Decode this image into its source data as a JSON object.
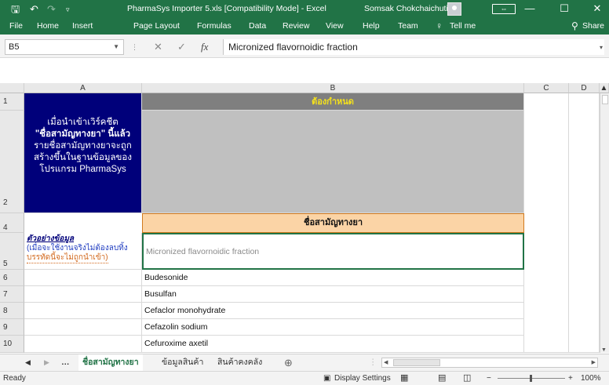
{
  "titlebar": {
    "title": "PharmaSys Importer 5.xls  [Compatibility Mode]  -  Excel",
    "user": "Somsak Chokchaichutigul",
    "ribbon_options": "⇔"
  },
  "ribbon_tabs": [
    "File",
    "Home",
    "Insert",
    "Page Layout",
    "Formulas",
    "Data",
    "Review",
    "View",
    "Help",
    "Team",
    "Tell me"
  ],
  "share_label": "Share",
  "formula_bar": {
    "name_box": "B5",
    "fx": "fx",
    "value": "Micronized flavornoidic fraction"
  },
  "columns": [
    "A",
    "B",
    "C",
    "D"
  ],
  "rows": [
    "1",
    "2",
    "4",
    "5",
    "6",
    "7",
    "8",
    "9",
    "10"
  ],
  "cells": {
    "A1_lines": [
      "เมื่อนำเข้าเวิร์คชีต",
      "\"ชื่อสามัญทางยา\" นี้แล้ว",
      "รายชื่อสามัญทางยาจะถูก",
      "สร้างขึ้นในฐานข้อมูลของ",
      "โปรแกรม PharmaSys"
    ],
    "B1": "ต้องกำหนด",
    "B4": "ชื่อสามัญทางยา",
    "A5_lines": [
      "ตัวอย่างข้อมูล",
      "(เมื่อจะใช้งานจริงไม่ต้องลบทิ้ง",
      "บรรทัดนี้จะไม่ถูกนำเข้า)"
    ],
    "B5": "Micronized flavornoidic fraction",
    "data_rows": [
      "Budesonide",
      "Busulfan",
      "Cefaclor monohydrate",
      "Cefazolin sodium",
      "Cefuroxime axetil"
    ]
  },
  "sheet_tabs": {
    "active": "ชื่อสามัญทางยา",
    "others": [
      "ข้อมูลสินค้า",
      "สินค้าคงคลัง"
    ]
  },
  "statusbar": {
    "ready": "Ready",
    "display_settings": "Display Settings",
    "zoom": "100%"
  },
  "colors": {
    "excel_green": "#217346",
    "header_navy": "#00007a",
    "required_yellow": "#f5e11c",
    "peach_header": "#fbd4a6"
  }
}
